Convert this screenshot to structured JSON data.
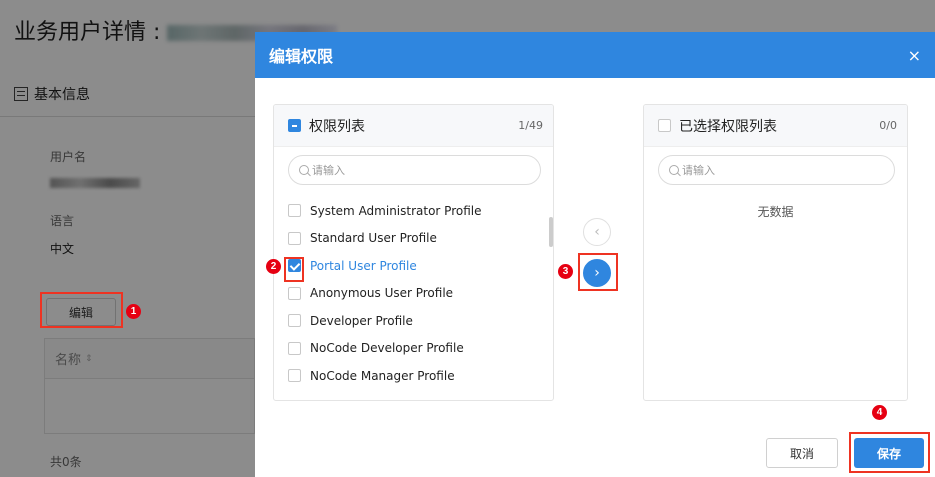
{
  "background": {
    "page_title": "业务用户详情 :",
    "section_title": "基本信息",
    "username_label": "用户名",
    "language_label": "语言",
    "language_value": "中文",
    "edit_button": "编辑",
    "table_header_name": "名称",
    "sort_icon": "sort-icon",
    "total": "共0条"
  },
  "dialog": {
    "title": "编辑权限",
    "close_icon": "×",
    "left_panel": {
      "title": "权限列表",
      "count": "1/49",
      "search_placeholder": "请输入",
      "items": [
        {
          "label": "System Administrator Profile",
          "checked": false
        },
        {
          "label": "Standard User Profile",
          "checked": false
        },
        {
          "label": "Portal User Profile",
          "checked": true
        },
        {
          "label": "Anonymous User Profile",
          "checked": false
        },
        {
          "label": "Developer Profile",
          "checked": false
        },
        {
          "label": "NoCode Developer Profile",
          "checked": false
        },
        {
          "label": "NoCode Manager Profile",
          "checked": false
        }
      ]
    },
    "right_panel": {
      "title": "已选择权限列表",
      "count": "0/0",
      "search_placeholder": "请输入",
      "empty_text": "无数据"
    },
    "move_left_icon": "‹",
    "move_right_icon": "›",
    "cancel_button": "取消",
    "save_button": "保存"
  },
  "annotations": [
    "1",
    "2",
    "3",
    "4"
  ],
  "colors": {
    "primary": "#2f86df",
    "annotation_red": "#e60012",
    "overlay": "rgba(0,0,0,0.45)"
  }
}
